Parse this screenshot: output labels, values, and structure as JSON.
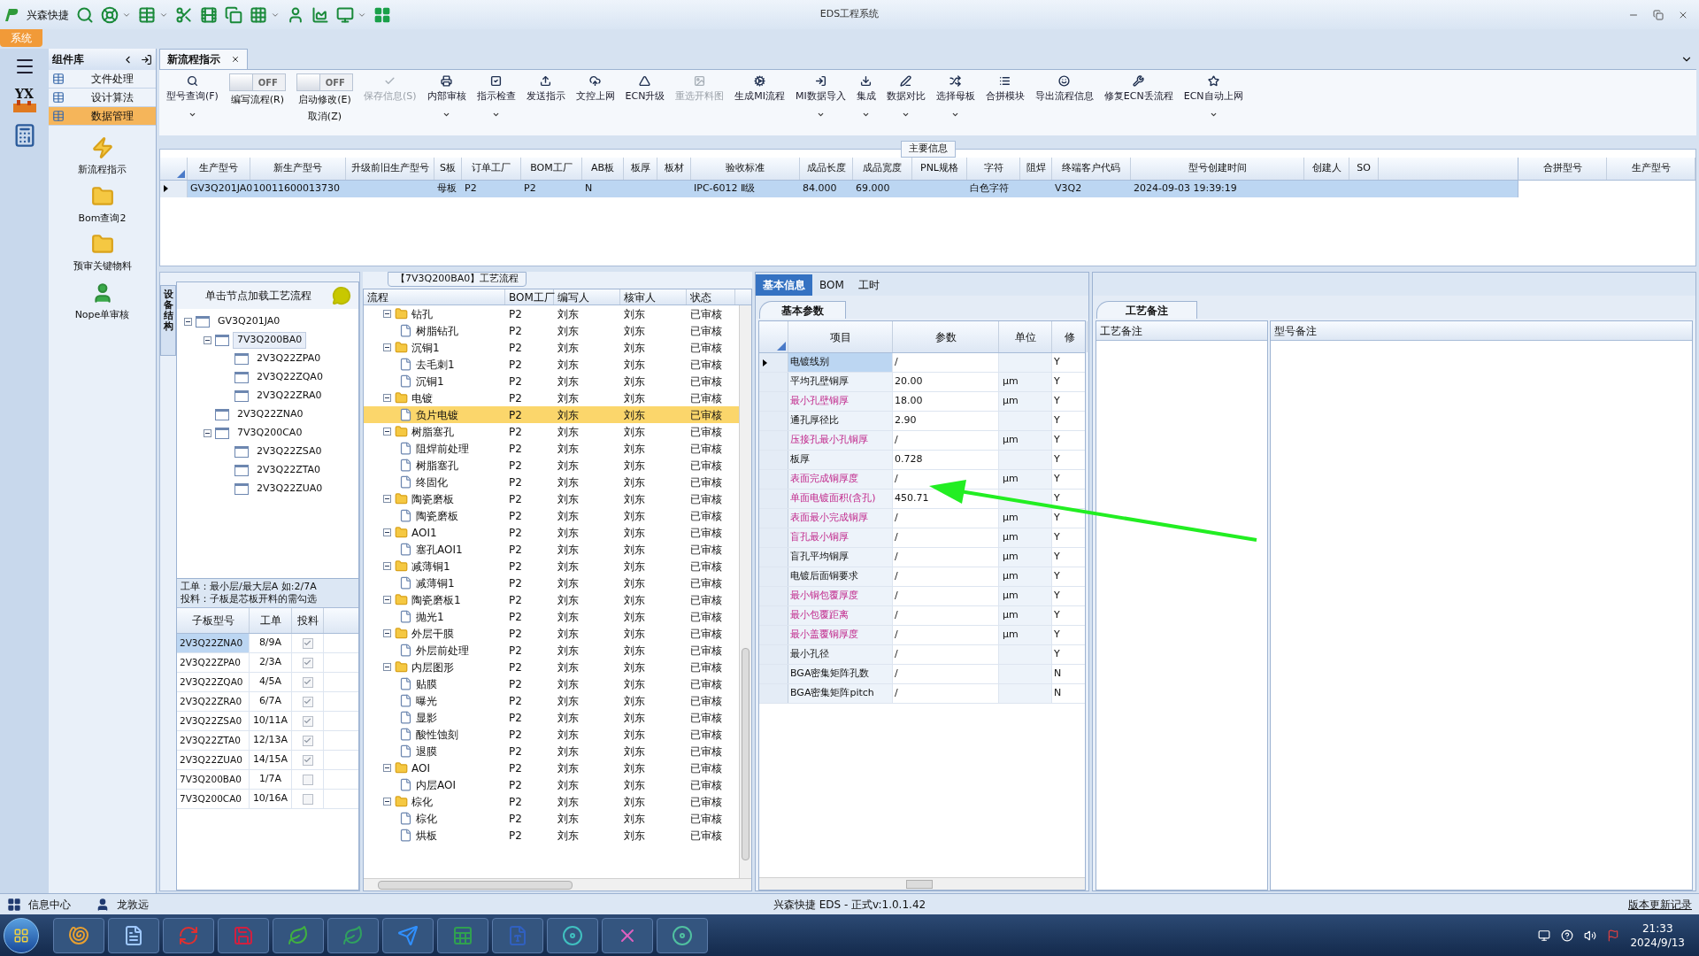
{
  "window": {
    "app_name": "兴森快捷",
    "title": "EDS工程系统"
  },
  "system_tab": {
    "label": "系统",
    "selected": true
  },
  "app_strip": {
    "logo": "YX"
  },
  "sidebar": {
    "title": "组件库",
    "items": [
      {
        "label": "文件处理",
        "selected": false
      },
      {
        "label": "设计算法",
        "selected": false
      },
      {
        "label": "数据管理",
        "selected": true
      }
    ],
    "tools": [
      {
        "kind": "bolt",
        "label": "新流程指示"
      },
      {
        "kind": "folder",
        "label": "Bom查询2"
      },
      {
        "kind": "folder",
        "label": "预审关键物料"
      },
      {
        "kind": "person",
        "label": "Nope单审核"
      }
    ]
  },
  "document_tabs": [
    {
      "label": "新流程指示",
      "selected": true
    }
  ],
  "toolbar": [
    {
      "kind": "button",
      "label": "型号查询(F)",
      "dropdown": true,
      "disabled": false
    },
    {
      "kind": "toggle",
      "label": "编写流程(R)",
      "switch_text": "OFF",
      "on": false
    },
    {
      "kind": "toggle",
      "label": "启动修改(E)",
      "sublabel": "取消(Z)",
      "switch_text": "OFF",
      "on": false
    },
    {
      "kind": "button",
      "label": "保存信息(S)",
      "dropdown": false,
      "disabled": true
    },
    {
      "kind": "button",
      "label": "内部审核",
      "dropdown": true,
      "disabled": false
    },
    {
      "kind": "button",
      "label": "指示检查",
      "dropdown": true,
      "disabled": false
    },
    {
      "kind": "button",
      "label": "发送指示",
      "dropdown": false,
      "disabled": false
    },
    {
      "kind": "button",
      "label": "文控上网",
      "dropdown": false,
      "disabled": false
    },
    {
      "kind": "button",
      "label": "ECN升级",
      "dropdown": false,
      "disabled": false
    },
    {
      "kind": "button",
      "label": "重选开料图",
      "dropdown": false,
      "disabled": true
    },
    {
      "kind": "button",
      "label": "生成MI流程",
      "dropdown": false,
      "disabled": false
    },
    {
      "kind": "button",
      "label": "MI数据导入",
      "dropdown": true,
      "disabled": false
    },
    {
      "kind": "button",
      "label": "集成",
      "dropdown": true,
      "disabled": false
    },
    {
      "kind": "button",
      "label": "数据对比",
      "dropdown": true,
      "disabled": false
    },
    {
      "kind": "button",
      "label": "选择母板",
      "dropdown": true,
      "disabled": false
    },
    {
      "kind": "button",
      "label": "合拼模块",
      "dropdown": false,
      "disabled": false
    },
    {
      "kind": "button",
      "label": "导出流程信息",
      "dropdown": false,
      "disabled": false
    },
    {
      "kind": "button",
      "label": "修复ECN丢流程",
      "dropdown": false,
      "disabled": false
    },
    {
      "kind": "button",
      "label": "ECN自动上网",
      "dropdown": true,
      "disabled": false
    }
  ],
  "main_info": {
    "legend": "主要信息",
    "columns": [
      "生产型号",
      "新生产型号",
      "升级前旧生产型号",
      "S板",
      "订单工厂",
      "BOM工厂",
      "AB板",
      "板厚",
      "板材",
      "验收标准",
      "成品长度",
      "成品宽度",
      "PNL规格",
      "字符",
      "阻焊",
      "终端客户代码",
      "型号创建时间",
      "创建人",
      "SO"
    ],
    "rows": [
      {
        "selected": true,
        "cells": [
          "GV3Q201JA0",
          "10011600013730",
          null,
          "母板",
          "P2",
          "P2",
          "N",
          null,
          null,
          "IPC-6012 Ⅱ级",
          "84.000",
          "69.000",
          null,
          "白色字符",
          null,
          "V3Q2",
          "2024-09-03 19:39:19",
          null,
          null
        ]
      }
    ],
    "side_columns": [
      "合拼型号",
      "生产型号"
    ]
  },
  "structure_panel": {
    "tab": "设备结构",
    "hint": "单击节点加载工艺流程",
    "tree": [
      {
        "label": "GV3Q201JA0",
        "expanded": true,
        "selected": false,
        "children": [
          {
            "label": "7V3Q200BA0",
            "expanded": true,
            "selected": true,
            "children": [
              {
                "label": "2V3Q22ZPA0",
                "selected": false
              },
              {
                "label": "2V3Q22ZQA0",
                "selected": false
              },
              {
                "label": "2V3Q22ZRA0",
                "selected": false
              }
            ]
          },
          {
            "label": "2V3Q22ZNA0",
            "selected": false
          },
          {
            "label": "7V3Q200CA0",
            "expanded": true,
            "selected": false,
            "children": [
              {
                "label": "2V3Q22ZSA0",
                "selected": false
              },
              {
                "label": "2V3Q22ZTA0",
                "selected": false
              },
              {
                "label": "2V3Q22ZUA0",
                "selected": false
              }
            ]
          }
        ]
      }
    ],
    "notes": [
      "工单：最小层/最大层A 如:2/7A",
      "投料：子板是芯板开料的需勾选"
    ],
    "columns": [
      "子板型号",
      "工单",
      "投料"
    ],
    "rows": [
      {
        "board": "2V3Q22ZNA0",
        "order": "8/9A",
        "checked": true,
        "selected": true
      },
      {
        "board": "2V3Q22ZPA0",
        "order": "2/3A",
        "checked": true,
        "selected": false
      },
      {
        "board": "2V3Q22ZQA0",
        "order": "4/5A",
        "checked": true,
        "selected": false
      },
      {
        "board": "2V3Q22ZRA0",
        "order": "6/7A",
        "checked": true,
        "selected": false
      },
      {
        "board": "2V3Q22ZSA0",
        "order": "10/11A",
        "checked": true,
        "selected": false
      },
      {
        "board": "2V3Q22ZTA0",
        "order": "12/13A",
        "checked": true,
        "selected": false
      },
      {
        "board": "2V3Q22ZUA0",
        "order": "14/15A",
        "checked": true,
        "selected": false
      },
      {
        "board": "7V3Q200BA0",
        "order": "1/7A",
        "checked": false,
        "selected": false
      },
      {
        "board": "7V3Q200CA0",
        "order": "10/16A",
        "checked": false,
        "selected": false
      }
    ]
  },
  "process_panel": {
    "title": "【7V3Q200BA0】工艺流程",
    "columns": [
      "流程",
      "BOM工厂",
      "编写人",
      "核审人",
      "状态"
    ],
    "rows": [
      {
        "label": "钻孔",
        "bom": "P2",
        "writer": "刘东",
        "reviewer": "刘东",
        "status": "已审核",
        "selected": false,
        "expanded": true,
        "children": [
          {
            "label": "树脂钻孔",
            "bom": "P2",
            "writer": "刘东",
            "reviewer": "刘东",
            "status": "已审核",
            "selected": false
          }
        ]
      },
      {
        "label": "沉铜1",
        "bom": "P2",
        "writer": "刘东",
        "reviewer": "刘东",
        "status": "已审核",
        "selected": false,
        "expanded": true,
        "children": [
          {
            "label": "去毛刺1",
            "bom": "P2",
            "writer": "刘东",
            "reviewer": "刘东",
            "status": "已审核",
            "selected": false
          },
          {
            "label": "沉铜1",
            "bom": "P2",
            "writer": "刘东",
            "reviewer": "刘东",
            "status": "已审核",
            "selected": false
          }
        ]
      },
      {
        "label": "电镀",
        "bom": "P2",
        "writer": "刘东",
        "reviewer": "刘东",
        "status": "已审核",
        "selected": false,
        "expanded": true,
        "children": [
          {
            "label": "负片电镀",
            "bom": "P2",
            "writer": "刘东",
            "reviewer": "刘东",
            "status": "已审核",
            "selected": true
          }
        ]
      },
      {
        "label": "树脂塞孔",
        "bom": "P2",
        "writer": "刘东",
        "reviewer": "刘东",
        "status": "已审核",
        "selected": false,
        "expanded": true,
        "children": [
          {
            "label": "阻焊前处理",
            "bom": "P2",
            "writer": "刘东",
            "reviewer": "刘东",
            "status": "已审核",
            "selected": false
          },
          {
            "label": "树脂塞孔",
            "bom": "P2",
            "writer": "刘东",
            "reviewer": "刘东",
            "status": "已审核",
            "selected": false
          },
          {
            "label": "终固化",
            "bom": "P2",
            "writer": "刘东",
            "reviewer": "刘东",
            "status": "已审核",
            "selected": false
          }
        ]
      },
      {
        "label": "陶瓷磨板",
        "bom": "P2",
        "writer": "刘东",
        "reviewer": "刘东",
        "status": "已审核",
        "selected": false,
        "expanded": true,
        "children": [
          {
            "label": "陶瓷磨板",
            "bom": "P2",
            "writer": "刘东",
            "reviewer": "刘东",
            "status": "已审核",
            "selected": false
          }
        ]
      },
      {
        "label": "AOI1",
        "bom": "P2",
        "writer": "刘东",
        "reviewer": "刘东",
        "status": "已审核",
        "selected": false,
        "expanded": true,
        "children": [
          {
            "label": "塞孔AOI1",
            "bom": "P2",
            "writer": "刘东",
            "reviewer": "刘东",
            "status": "已审核",
            "selected": false
          }
        ]
      },
      {
        "label": "减薄铜1",
        "bom": "P2",
        "writer": "刘东",
        "reviewer": "刘东",
        "status": "已审核",
        "selected": false,
        "expanded": true,
        "children": [
          {
            "label": "减薄铜1",
            "bom": "P2",
            "writer": "刘东",
            "reviewer": "刘东",
            "status": "已审核",
            "selected": false
          }
        ]
      },
      {
        "label": "陶瓷磨板1",
        "bom": "P2",
        "writer": "刘东",
        "reviewer": "刘东",
        "status": "已审核",
        "selected": false,
        "expanded": true,
        "children": [
          {
            "label": "抛光1",
            "bom": "P2",
            "writer": "刘东",
            "reviewer": "刘东",
            "status": "已审核",
            "selected": false
          }
        ]
      },
      {
        "label": "外层干膜",
        "bom": "P2",
        "writer": "刘东",
        "reviewer": "刘东",
        "status": "已审核",
        "selected": false,
        "expanded": true,
        "children": [
          {
            "label": "外层前处理",
            "bom": "P2",
            "writer": "刘东",
            "reviewer": "刘东",
            "status": "已审核",
            "selected": false
          }
        ]
      },
      {
        "label": "内层图形",
        "bom": "P2",
        "writer": "刘东",
        "reviewer": "刘东",
        "status": "已审核",
        "selected": false,
        "expanded": true,
        "children": [
          {
            "label": "贴膜",
            "bom": "P2",
            "writer": "刘东",
            "reviewer": "刘东",
            "status": "已审核",
            "selected": false
          },
          {
            "label": "曝光",
            "bom": "P2",
            "writer": "刘东",
            "reviewer": "刘东",
            "status": "已审核",
            "selected": false
          },
          {
            "label": "显影",
            "bom": "P2",
            "writer": "刘东",
            "reviewer": "刘东",
            "status": "已审核",
            "selected": false
          },
          {
            "label": "酸性蚀刻",
            "bom": "P2",
            "writer": "刘东",
            "reviewer": "刘东",
            "status": "已审核",
            "selected": false
          },
          {
            "label": "退膜",
            "bom": "P2",
            "writer": "刘东",
            "reviewer": "刘东",
            "status": "已审核",
            "selected": false
          }
        ]
      },
      {
        "label": "AOI",
        "bom": "P2",
        "writer": "刘东",
        "reviewer": "刘东",
        "status": "已审核",
        "selected": false,
        "expanded": true,
        "children": [
          {
            "label": "内层AOI",
            "bom": "P2",
            "writer": "刘东",
            "reviewer": "刘东",
            "status": "已审核",
            "selected": false
          }
        ]
      },
      {
        "label": "棕化",
        "bom": "P2",
        "writer": "刘东",
        "reviewer": "刘东",
        "status": "已审核",
        "selected": false,
        "expanded": true,
        "children": [
          {
            "label": "棕化",
            "bom": "P2",
            "writer": "刘东",
            "reviewer": "刘东",
            "status": "已审核",
            "selected": false
          },
          {
            "label": "烘板",
            "bom": "P2",
            "writer": "刘东",
            "reviewer": "刘东",
            "status": "已审核",
            "selected": false
          }
        ]
      }
    ]
  },
  "detail_panel": {
    "tabs": [
      {
        "label": "基本信息",
        "selected": true
      },
      {
        "label": "BOM",
        "selected": false
      },
      {
        "label": "工时",
        "selected": false
      }
    ],
    "subtab": "基本参数",
    "columns": [
      "项目",
      "参数",
      "单位",
      "修"
    ],
    "rows": [
      {
        "item": "电镀线别",
        "value": "/",
        "modified": "Y",
        "highlight": false,
        "selected": true
      },
      {
        "item": "平均孔壁铜厚",
        "value": "20.00",
        "unit": "μm",
        "modified": "Y",
        "highlight": false,
        "selected": false
      },
      {
        "item": "最小孔壁铜厚",
        "value": "18.00",
        "unit": "μm",
        "modified": "Y",
        "highlight": true,
        "selected": false
      },
      {
        "item": "通孔厚径比",
        "value": "2.90",
        "modified": "Y",
        "highlight": false,
        "selected": false
      },
      {
        "item": "压接孔最小孔铜厚",
        "value": "/",
        "unit": "μm",
        "modified": "Y",
        "highlight": true,
        "selected": false
      },
      {
        "item": "板厚",
        "value": "0.728",
        "modified": "Y",
        "highlight": false,
        "selected": false
      },
      {
        "item": "表面完成铜厚度",
        "value": "/",
        "unit": "μm",
        "modified": "Y",
        "highlight": true,
        "selected": false
      },
      {
        "item": "单面电镀面积(含孔)",
        "value": "450.71",
        "modified": "Y",
        "highlight": true,
        "selected": false
      },
      {
        "item": "表面最小完成铜厚",
        "value": "/",
        "unit": "μm",
        "modified": "Y",
        "highlight": true,
        "selected": false
      },
      {
        "item": "盲孔最小铜厚",
        "value": "/",
        "unit": "μm",
        "modified": "Y",
        "highlight": true,
        "selected": false
      },
      {
        "item": "盲孔平均铜厚",
        "value": "/",
        "unit": "μm",
        "modified": "Y",
        "highlight": false,
        "selected": false
      },
      {
        "item": "电镀后面铜要求",
        "value": "/",
        "unit": "μm",
        "modified": "Y",
        "highlight": false,
        "selected": false
      },
      {
        "item": "最小铜包覆厚度",
        "value": "/",
        "unit": "μm",
        "modified": "Y",
        "highlight": true,
        "selected": false
      },
      {
        "item": "最小包覆距离",
        "value": "/",
        "unit": "μm",
        "modified": "Y",
        "highlight": true,
        "selected": false
      },
      {
        "item": "最小盖覆铜厚度",
        "value": "/",
        "unit": "μm",
        "modified": "Y",
        "highlight": true,
        "selected": false
      },
      {
        "item": "最小孔径",
        "value": "/",
        "modified": "Y",
        "highlight": false,
        "selected": false
      },
      {
        "item": "BGA密集矩阵孔数",
        "value": "/",
        "modified": "N",
        "highlight": false,
        "selected": false
      },
      {
        "item": "BGA密集矩阵pitch",
        "value": "/",
        "modified": "N",
        "highlight": false,
        "selected": false
      }
    ]
  },
  "notes_panel": {
    "tab": "工艺备注",
    "columns": [
      "工艺备注",
      "型号备注"
    ]
  },
  "status_bar": {
    "info_center": "信息中心",
    "user": "龙敦远",
    "version": "兴森快捷 EDS - 正式v:1.0.1.42",
    "changelog_link": "版本更新记录"
  },
  "taskbar": {
    "time": "21:33",
    "date": "2024/9/13"
  }
}
